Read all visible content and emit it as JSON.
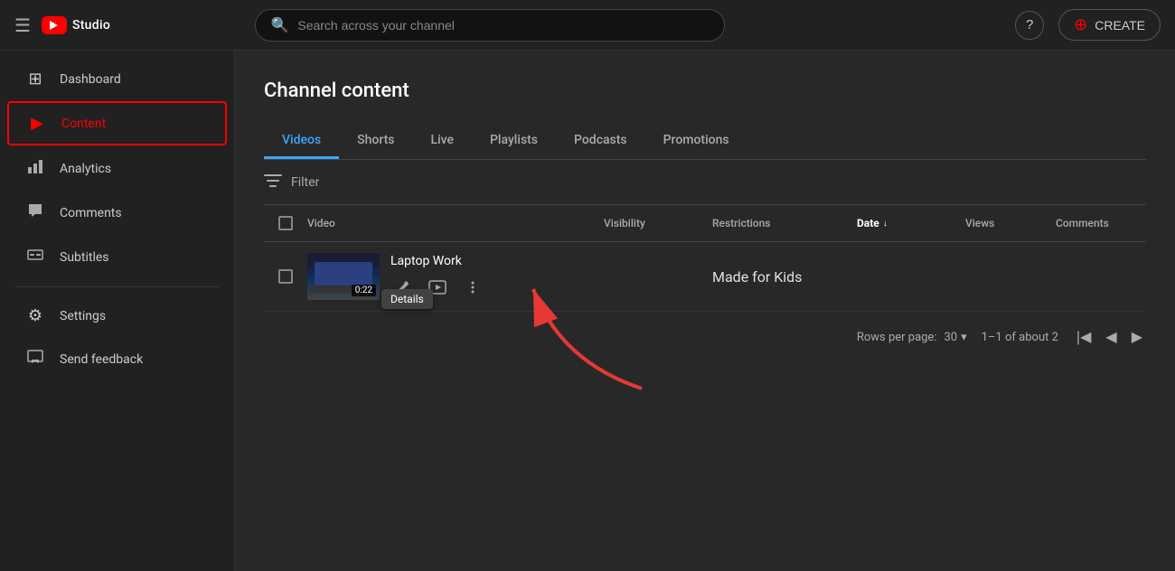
{
  "topnav": {
    "hamburger_label": "☰",
    "logo_text": "Studio",
    "search_placeholder": "Search across your channel",
    "help_label": "?",
    "create_label": "CREATE"
  },
  "sidebar": {
    "items": [
      {
        "id": "dashboard",
        "label": "Dashboard",
        "icon": "⊞"
      },
      {
        "id": "content",
        "label": "Content",
        "icon": "▶",
        "active": true
      },
      {
        "id": "analytics",
        "label": "Analytics",
        "icon": "📊"
      },
      {
        "id": "comments",
        "label": "Comments",
        "icon": "💬"
      },
      {
        "id": "subtitles",
        "label": "Subtitles",
        "icon": "≡"
      }
    ],
    "bottom_items": [
      {
        "id": "settings",
        "label": "Settings",
        "icon": "⚙"
      },
      {
        "id": "feedback",
        "label": "Send feedback",
        "icon": "⚠"
      }
    ]
  },
  "content": {
    "page_title": "Channel content",
    "tabs": [
      {
        "id": "videos",
        "label": "Videos",
        "active": true
      },
      {
        "id": "shorts",
        "label": "Shorts",
        "active": false
      },
      {
        "id": "live",
        "label": "Live",
        "active": false
      },
      {
        "id": "playlists",
        "label": "Playlists",
        "active": false
      },
      {
        "id": "podcasts",
        "label": "Podcasts",
        "active": false
      },
      {
        "id": "promotions",
        "label": "Promotions",
        "active": false
      }
    ],
    "filter_label": "Filter",
    "table": {
      "headers": [
        {
          "id": "video",
          "label": "Video"
        },
        {
          "id": "visibility",
          "label": "Visibility"
        },
        {
          "id": "restrictions",
          "label": "Restrictions"
        },
        {
          "id": "date",
          "label": "Date",
          "sorted": true
        },
        {
          "id": "views",
          "label": "Views"
        },
        {
          "id": "comments",
          "label": "Comments"
        }
      ],
      "rows": [
        {
          "title": "Laptop Work",
          "duration": "0:22",
          "visibility": "",
          "restrictions": "Made for Kids",
          "date": "",
          "views": "",
          "comments": ""
        }
      ]
    },
    "tooltip_label": "Details",
    "footer": {
      "rows_per_page_label": "Rows per page:",
      "rows_value": "30",
      "pagination_label": "1–1 of about 2"
    }
  }
}
